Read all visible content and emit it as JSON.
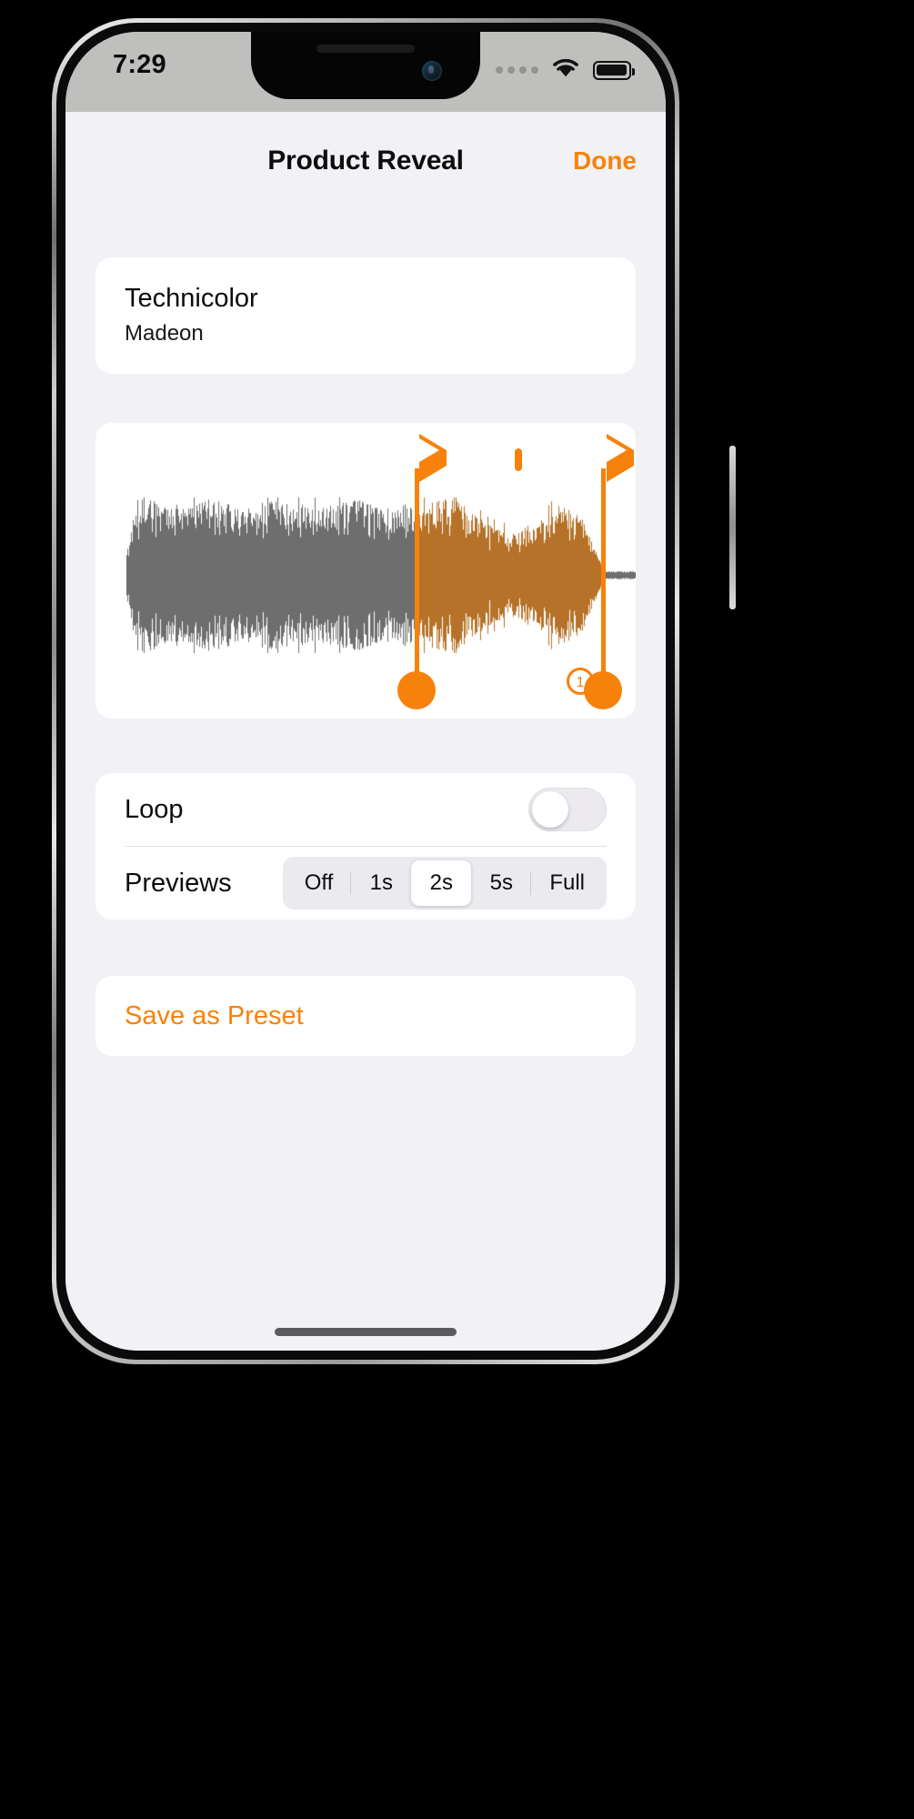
{
  "status_bar": {
    "time": "7:29",
    "cellular_icon": "cellular-dots-icon",
    "wifi_icon": "wifi-icon",
    "battery_icon": "battery-full-icon"
  },
  "nav": {
    "title": "Product Reveal",
    "done_label": "Done"
  },
  "track": {
    "title": "Technicolor",
    "artist": "Madeon"
  },
  "waveform": {
    "play_start_icon": "play-triangle-icon",
    "stop_icon": "stop-square-icon",
    "play_end_icon": "play-triangle-icon",
    "zoom_icon": "magnifier-zoom-level-icon",
    "zoom_level": "1",
    "selection_start_pct": 56,
    "selection_end_pct": 92,
    "unselected_color": "#6e6e6e",
    "selected_color": "#b57228",
    "handle_color": "#f7820b"
  },
  "settings": {
    "loop": {
      "label": "Loop",
      "value": "off"
    },
    "previews": {
      "label": "Previews",
      "options": [
        "Off",
        "1s",
        "2s",
        "5s",
        "Full"
      ],
      "selected": "2s"
    }
  },
  "preset": {
    "label": "Save as Preset"
  },
  "colors": {
    "accent": "#f7820b",
    "page_background": "#f2f1f6",
    "card_background": "#ffffff",
    "status_bar_background": "#bfc0bd"
  }
}
